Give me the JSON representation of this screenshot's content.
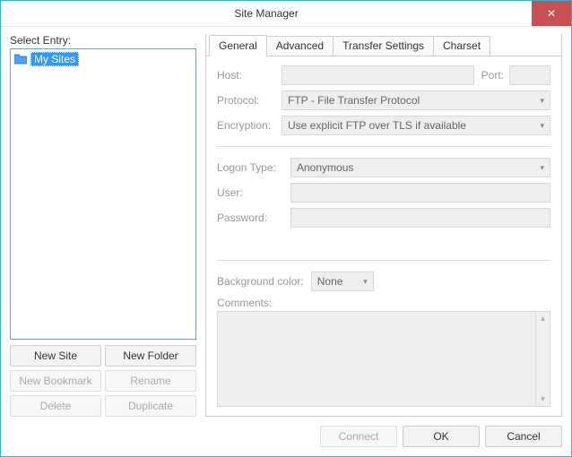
{
  "window": {
    "title": "Site Manager",
    "close_symbol": "✕"
  },
  "left": {
    "select_entry_label": "Select Entry:",
    "tree": {
      "root": {
        "label": "My Sites"
      }
    },
    "buttons": {
      "new_site": "New Site",
      "new_folder": "New Folder",
      "new_bookmark": "New Bookmark",
      "rename": "Rename",
      "delete": "Delete",
      "duplicate": "Duplicate"
    }
  },
  "tabs": {
    "general": "General",
    "advanced": "Advanced",
    "transfer": "Transfer Settings",
    "charset": "Charset"
  },
  "general": {
    "labels": {
      "host": "Host:",
      "port": "Port:",
      "protocol": "Protocol:",
      "encryption": "Encryption:",
      "logon_type": "Logon Type:",
      "user": "User:",
      "password": "Password:",
      "background_color": "Background color:",
      "comments": "Comments:"
    },
    "values": {
      "host": "",
      "port": "",
      "protocol": "FTP - File Transfer Protocol",
      "encryption": "Use explicit FTP over TLS if available",
      "logon_type": "Anonymous",
      "user": "",
      "password": "",
      "background_color": "None",
      "comments": ""
    }
  },
  "footer": {
    "connect": "Connect",
    "ok": "OK",
    "cancel": "Cancel"
  }
}
